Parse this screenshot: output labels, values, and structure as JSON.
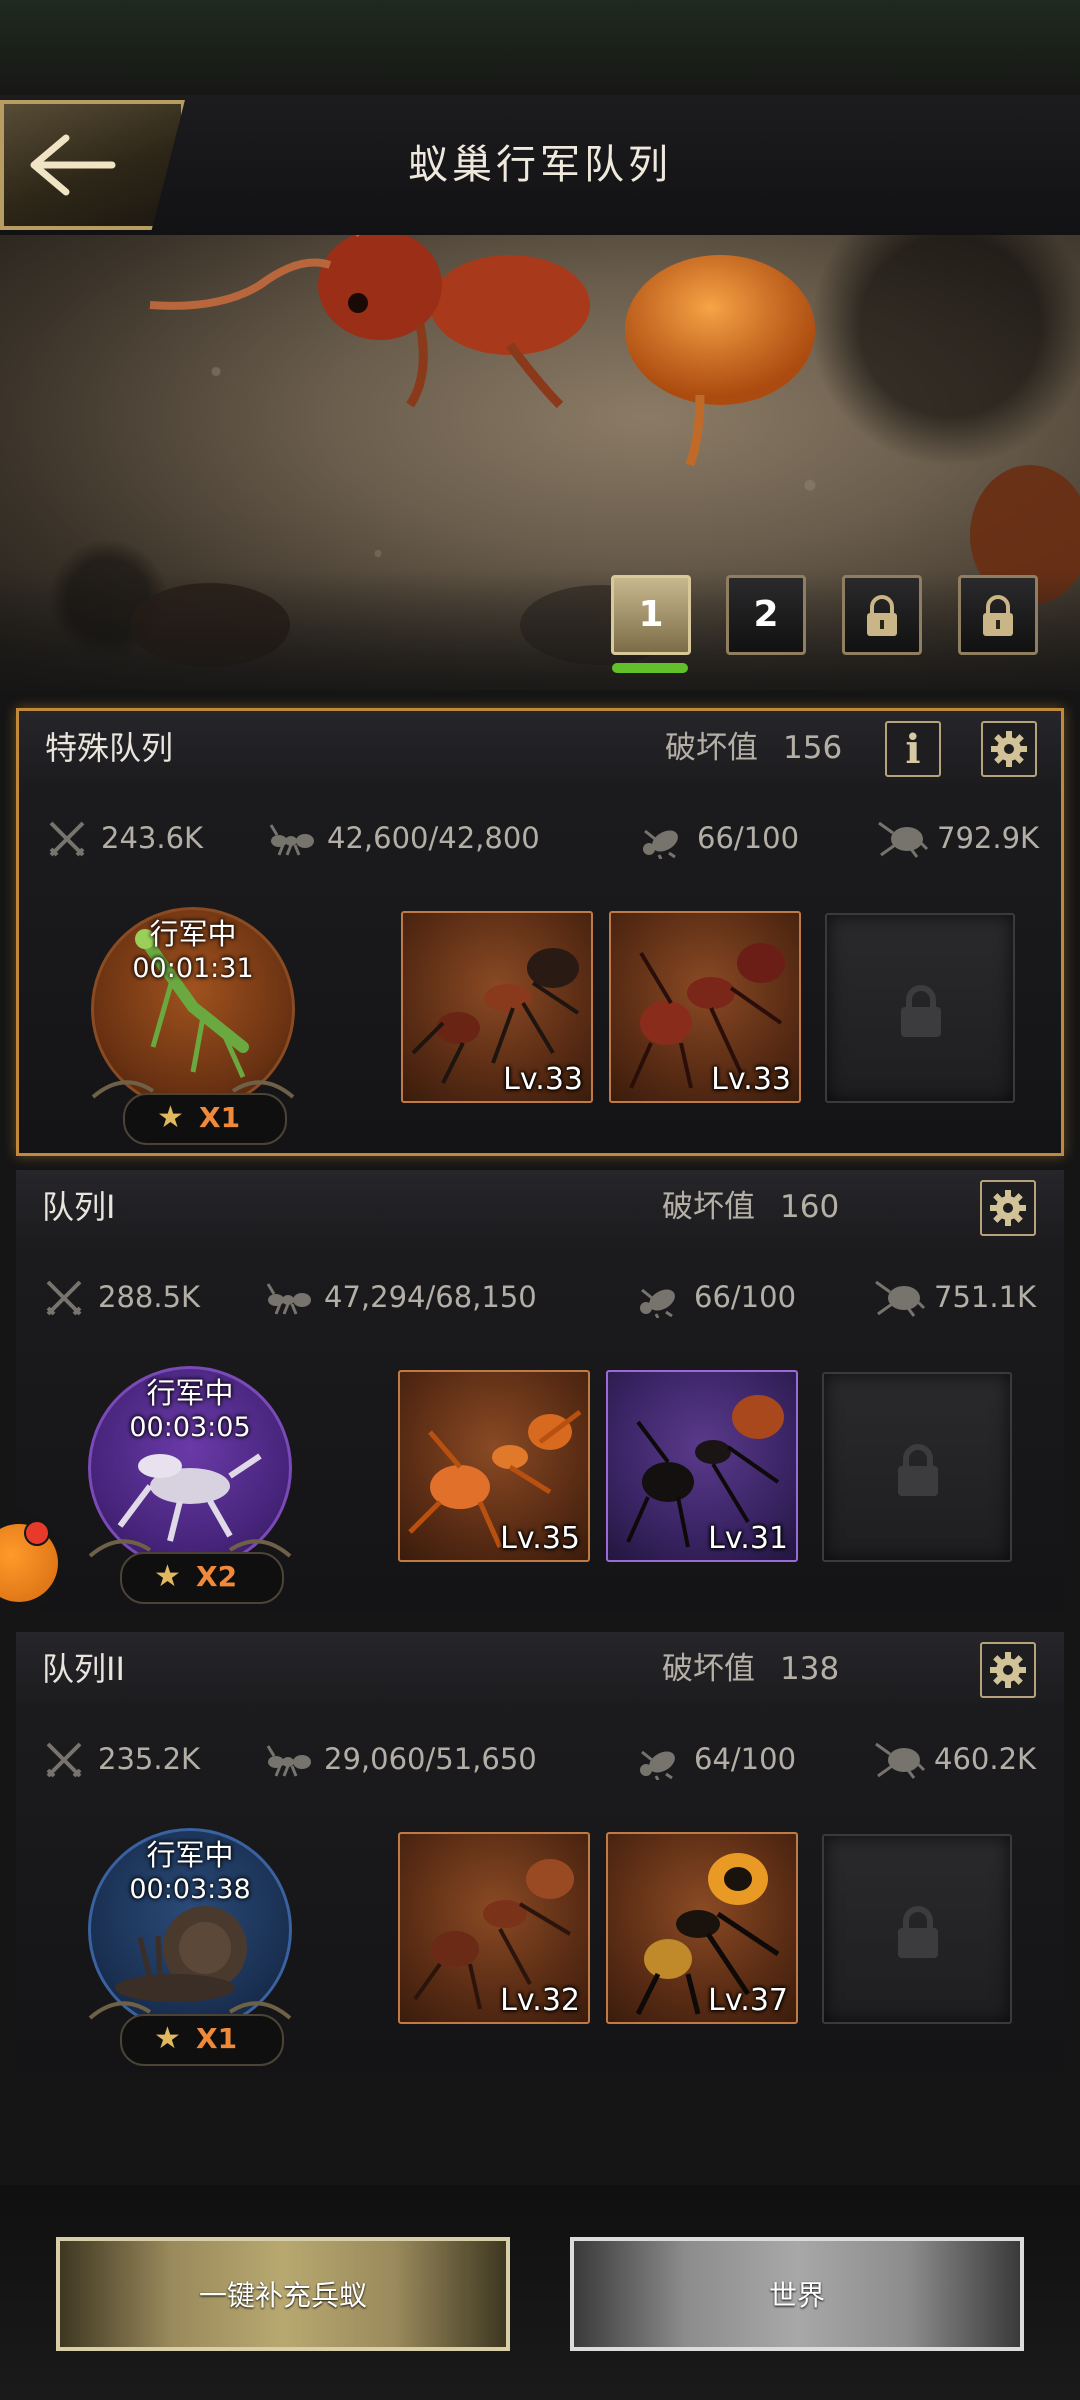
{
  "header": {
    "title": "蚁巢行军队列"
  },
  "pages": {
    "items": [
      "1",
      "2"
    ],
    "active": "1"
  },
  "queues": [
    {
      "name": "特殊队列",
      "damage_label": "破坏值",
      "damage_value": "156",
      "attack": "243.6K",
      "troops": "42,600/42,800",
      "load": "66/100",
      "power": "792.9K",
      "status": "行军中",
      "timer": "00:01:31",
      "star_mult": "X1",
      "units": [
        {
          "level": "Lv.33"
        },
        {
          "level": "Lv.33"
        }
      ]
    },
    {
      "name": "队列I",
      "damage_label": "破坏值",
      "damage_value": "160",
      "attack": "288.5K",
      "troops": "47,294/68,150",
      "load": "66/100",
      "power": "751.1K",
      "status": "行军中",
      "timer": "00:03:05",
      "star_mult": "X2",
      "units": [
        {
          "level": "Lv.35"
        },
        {
          "level": "Lv.31"
        }
      ]
    },
    {
      "name": "队列II",
      "damage_label": "破坏值",
      "damage_value": "138",
      "attack": "235.2K",
      "troops": "29,060/51,650",
      "load": "64/100",
      "power": "460.2K",
      "status": "行军中",
      "timer": "00:03:38",
      "star_mult": "X1",
      "units": [
        {
          "level": "Lv.32"
        },
        {
          "level": "Lv.37"
        }
      ]
    }
  ],
  "footer": {
    "refill_label": "一键补充兵蚁",
    "world_label": "世界"
  },
  "colors": {
    "accent_gold": "#b89d63",
    "active_indicator": "#62c02a",
    "mult_orange": "#f08a3a",
    "special_border": "#c08a3a"
  }
}
